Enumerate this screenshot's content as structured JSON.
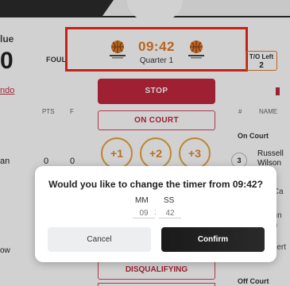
{
  "scoreboard": {
    "left_team": {
      "name_fragment": "lue",
      "score_fragment": "0",
      "fouls_label": "FOULS",
      "undo_fragment": "ndo"
    },
    "timer": {
      "time": "09:42",
      "quarter": "Quarter 1"
    },
    "timeouts": {
      "label": "T/O Left",
      "value": "2"
    }
  },
  "controls": {
    "stop_label": "STOP",
    "on_court_label": "ON COURT",
    "plus1": "+1",
    "plus2": "+2",
    "plus3": "+3",
    "disqualifying_label": "DISQUALIFYING"
  },
  "left_table": {
    "headers": {
      "pts": "PTS",
      "f": "F"
    },
    "row": {
      "name_fragment": "an",
      "pts": "0",
      "f": "0"
    },
    "row2_fragment": "ow"
  },
  "right_roster": {
    "headers": {
      "number": "#",
      "name": "NAME"
    },
    "on_court_label": "On Court",
    "player": {
      "number": "3",
      "name": "Russell Wilson"
    },
    "fragments": [
      "k Ca",
      "aun on",
      "n ert"
    ],
    "off_court_label": "Off Court"
  },
  "modal": {
    "title": "Would you like to change the timer from 09:42?",
    "mm_label": "MM",
    "ss_label": "SS",
    "mm_placeholder": "09",
    "ss_placeholder": "42",
    "separator": ":",
    "cancel_label": "Cancel",
    "confirm_label": "Confirm"
  },
  "colors": {
    "accent_red": "#c1283e",
    "highlight_red": "#ee2b1c",
    "timer_orange": "#e07a2a",
    "dark": "#1a1a1a"
  }
}
